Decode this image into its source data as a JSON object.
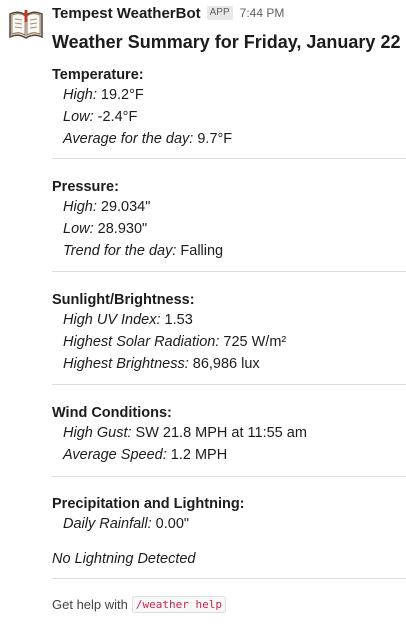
{
  "message": {
    "sender": "Tempest WeatherBot",
    "badge": "APP",
    "time": "7:44 PM",
    "title": "Weather Summary for Friday, January 22"
  },
  "temperature": {
    "heading": "Temperature:",
    "high_label": "High:",
    "high_value": " 19.2°F",
    "low_label": "Low:",
    "low_value": " -2.4°F",
    "avg_label": "Average for the day:",
    "avg_value": " 9.7°F"
  },
  "pressure": {
    "heading": "Pressure:",
    "high_label": "High:",
    "high_value": " 29.034\"",
    "low_label": "Low:",
    "low_value": " 28.930\"",
    "trend_label": "Trend for the day:",
    "trend_value": " Falling"
  },
  "sunlight": {
    "heading": "Sunlight/Brightness:",
    "uv_label": "High UV Index:",
    "uv_value": " 1.53",
    "solar_label": "Highest Solar Radiation:",
    "solar_value": " 725 W/m²",
    "bright_label": "Highest Brightness:",
    "bright_value": " 86,986 lux"
  },
  "wind": {
    "heading": "Wind Conditions:",
    "gust_label": "High Gust:",
    "gust_value": " SW 21.8 MPH at 11:55 am",
    "avg_label": "Average Speed:",
    "avg_value": " 1.2 MPH"
  },
  "precip": {
    "heading": "Precipitation and Lightning:",
    "rain_label": "Daily Rainfall:",
    "rain_value": " 0.00\"",
    "lightning": "No Lightning Detected"
  },
  "help": {
    "text": "Get help with",
    "command": "/weather help"
  },
  "icons": {
    "avatar": "open-book-icon"
  },
  "colors": {
    "code_text": "#c7254e",
    "divider": "#dddddd"
  }
}
